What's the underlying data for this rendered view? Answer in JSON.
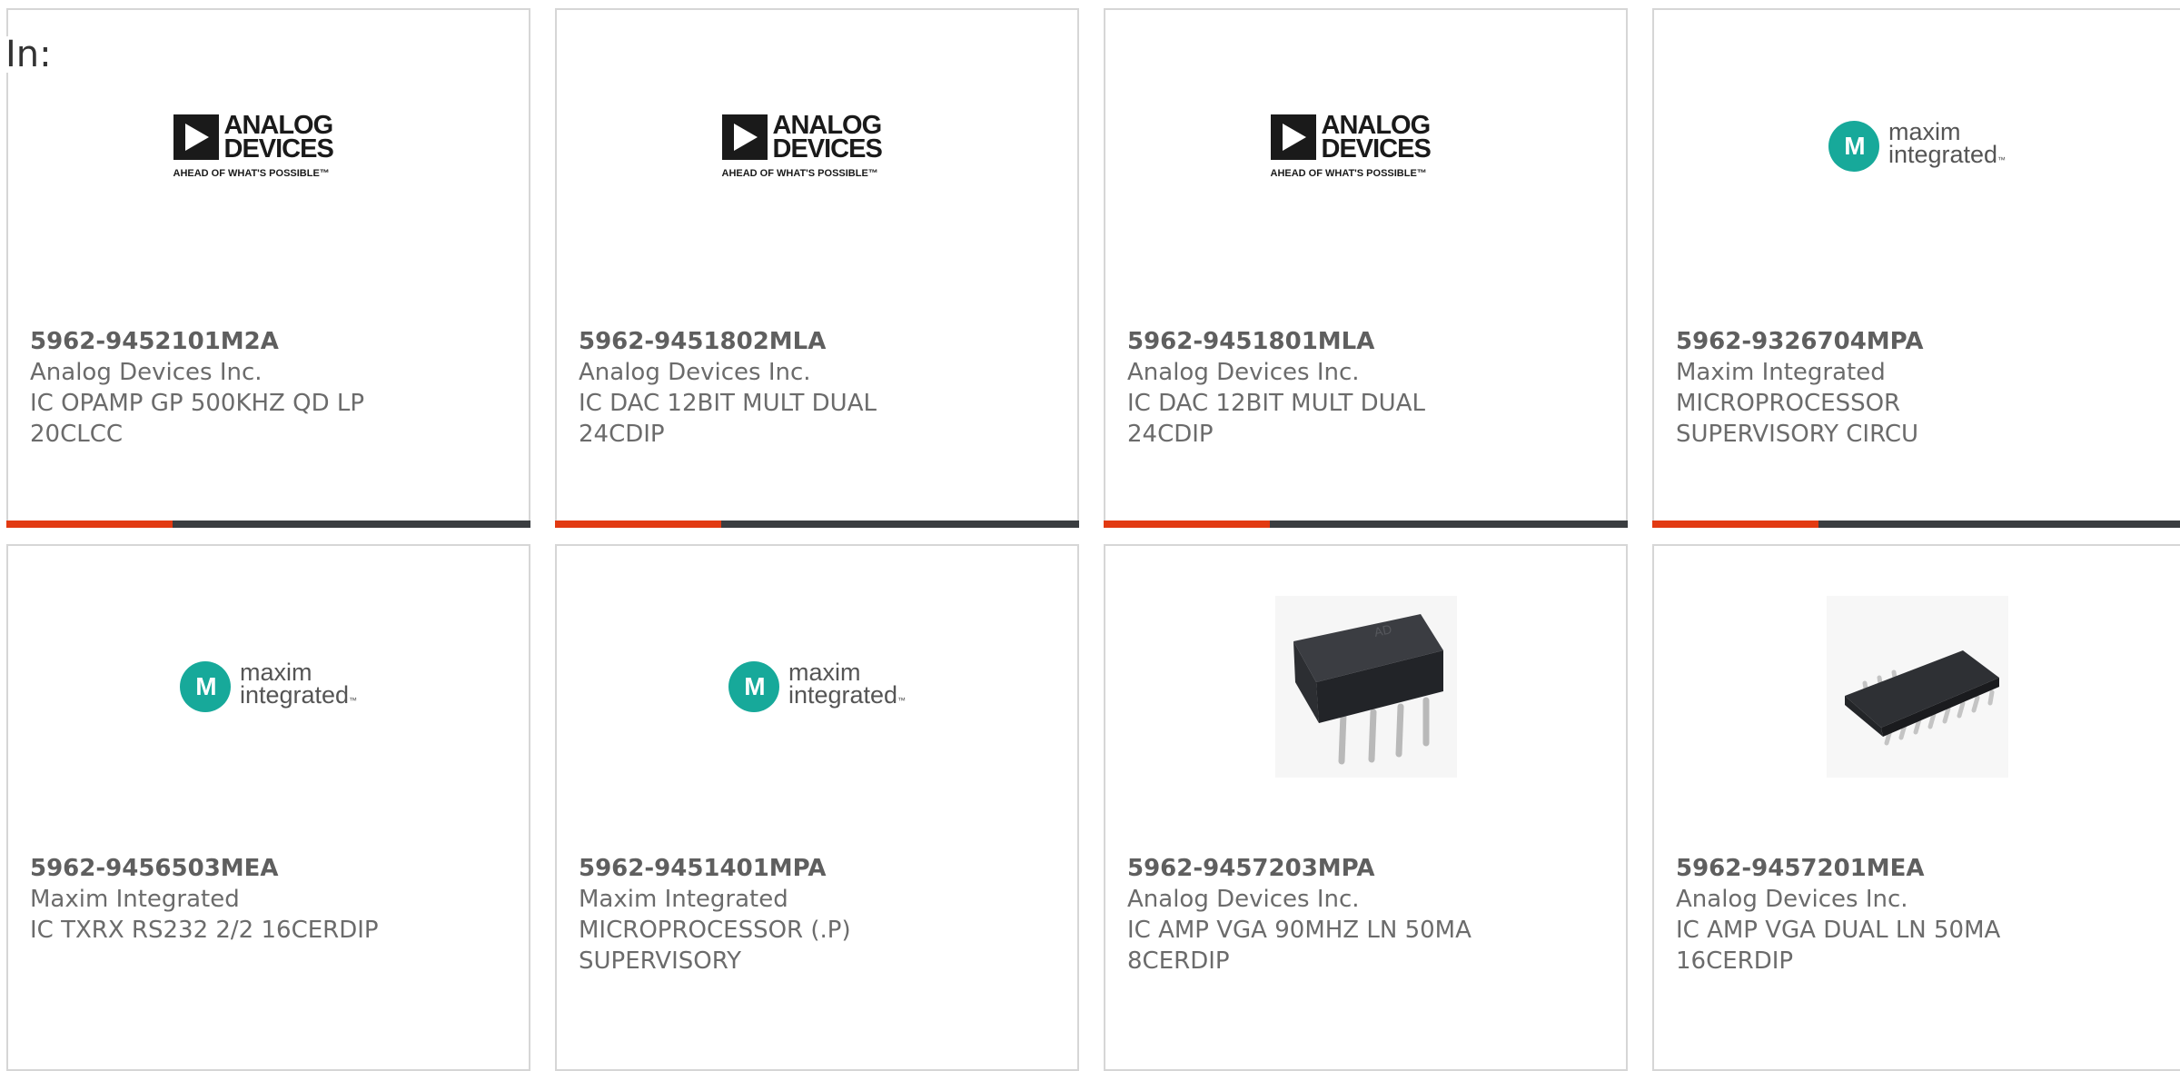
{
  "filter_label": "In:",
  "colors": {
    "accent": "#e23a12",
    "bar": "#3a3d40",
    "maxim": "#17a99a"
  },
  "products": [
    {
      "part_number": "5962-9452101M2A",
      "manufacturer": "Analog Devices Inc.",
      "description": "IC OPAMP GP 500KHZ QD LP\n20CLCC",
      "image": "analog-devices-logo",
      "logo_text": [
        "ANALOG",
        "DEVICES"
      ],
      "logo_tagline": "AHEAD OF WHAT'S POSSIBLE™"
    },
    {
      "part_number": "5962-9451802MLA",
      "manufacturer": "Analog Devices Inc.",
      "description": "IC DAC 12BIT MULT DUAL\n24CDIP",
      "image": "analog-devices-logo",
      "logo_text": [
        "ANALOG",
        "DEVICES"
      ],
      "logo_tagline": "AHEAD OF WHAT'S POSSIBLE™"
    },
    {
      "part_number": "5962-9451801MLA",
      "manufacturer": "Analog Devices Inc.",
      "description": "IC DAC 12BIT MULT DUAL\n24CDIP",
      "image": "analog-devices-logo",
      "logo_text": [
        "ANALOG",
        "DEVICES"
      ],
      "logo_tagline": "AHEAD OF WHAT'S POSSIBLE™"
    },
    {
      "part_number": "5962-9326704MPA",
      "manufacturer": "Maxim Integrated",
      "description": "MICROPROCESSOR\nSUPERVISORY CIRCU",
      "image": "maxim-logo",
      "logo_text": [
        "maxim",
        "integrated"
      ]
    },
    {
      "part_number": "5962-9456503MEA",
      "manufacturer": "Maxim Integrated",
      "description": "IC TXRX RS232 2/2 16CERDIP",
      "image": "maxim-logo",
      "logo_text": [
        "maxim",
        "integrated"
      ]
    },
    {
      "part_number": "5962-9451401MPA",
      "manufacturer": "Maxim Integrated",
      "description": "MICROPROCESSOR (.P)\nSUPERVISORY",
      "image": "maxim-logo",
      "logo_text": [
        "maxim",
        "integrated"
      ]
    },
    {
      "part_number": "5962-9457203MPA",
      "manufacturer": "Analog Devices Inc.",
      "description": "IC AMP VGA 90MHZ LN 50MA\n8CERDIP",
      "image": "cerdip-chip-photo"
    },
    {
      "part_number": "5962-9457201MEA",
      "manufacturer": "Analog Devices Inc.",
      "description": "IC AMP VGA DUAL LN 50MA\n16CERDIP",
      "image": "soic-chip-photo"
    }
  ]
}
